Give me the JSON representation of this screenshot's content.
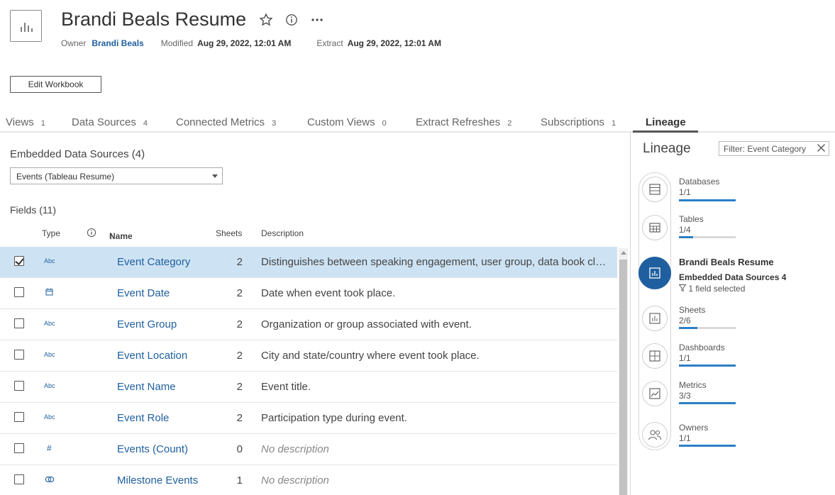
{
  "header": {
    "title": "Brandi Beals Resume",
    "owner_label": "Owner",
    "owner_value": "Brandi Beals",
    "modified_label": "Modified",
    "modified_value": "Aug 29, 2022, 12:01 AM",
    "extract_label": "Extract",
    "extract_value": "Aug 29, 2022, 12:01 AM",
    "edit_button": "Edit Workbook"
  },
  "tabs": [
    {
      "label": "Views",
      "count": "1"
    },
    {
      "label": "Data Sources",
      "count": "4"
    },
    {
      "label": "Connected Metrics",
      "count": "3"
    },
    {
      "label": "Custom Views",
      "count": "0"
    },
    {
      "label": "Extract Refreshes",
      "count": "2"
    },
    {
      "label": "Subscriptions",
      "count": "1"
    },
    {
      "label": "Lineage",
      "count": ""
    }
  ],
  "main": {
    "embedded_label": "Embedded Data Sources (4)",
    "select_value": "Events (Tableau Resume)",
    "fields_label": "Fields (11)",
    "columns": {
      "type": "Type",
      "name": "Name",
      "sort_arrow": "↑",
      "sheets": "Sheets",
      "description": "Description"
    },
    "rows": [
      {
        "checked": true,
        "type_icon": "abc-icon",
        "type_text": "Abc",
        "name": "Event Category",
        "sheets": "2",
        "description": "Distinguishes between speaking engagement, user group, data book club or other event types.",
        "empty": false
      },
      {
        "checked": false,
        "type_icon": "calendar-icon",
        "type_text": "",
        "name": "Event Date",
        "sheets": "2",
        "description": "Date when event took place.",
        "empty": false
      },
      {
        "checked": false,
        "type_icon": "abc-icon",
        "type_text": "Abc",
        "name": "Event Group",
        "sheets": "2",
        "description": "Organization or group associated with event.",
        "empty": false
      },
      {
        "checked": false,
        "type_icon": "abc-icon",
        "type_text": "Abc",
        "name": "Event Location",
        "sheets": "2",
        "description": "City and state/country where event took place.",
        "empty": false
      },
      {
        "checked": false,
        "type_icon": "abc-icon",
        "type_text": "Abc",
        "name": "Event Name",
        "sheets": "2",
        "description": "Event title.",
        "empty": false
      },
      {
        "checked": false,
        "type_icon": "abc-icon",
        "type_text": "Abc",
        "name": "Event Role",
        "sheets": "2",
        "description": "Participation type during event.",
        "empty": false
      },
      {
        "checked": false,
        "type_icon": "hash-icon",
        "type_text": "#",
        "name": "Events (Count)",
        "sheets": "0",
        "description": "No description",
        "empty": true
      },
      {
        "checked": false,
        "type_icon": "link-icon",
        "type_text": "",
        "name": "Milestone Events",
        "sheets": "1",
        "description": "No description",
        "empty": true
      }
    ]
  },
  "lineage": {
    "title": "Lineage",
    "filter": "Filter: Event Category",
    "items": [
      {
        "label": "Databases",
        "count": "1/1",
        "fraction": 1.0
      },
      {
        "label": "Tables",
        "count": "1/4",
        "fraction": 0.25
      },
      {
        "label": "Sheets",
        "count": "2/6",
        "fraction": 0.33
      },
      {
        "label": "Dashboards",
        "count": "1/1",
        "fraction": 1.0
      },
      {
        "label": "Metrics",
        "count": "3/3",
        "fraction": 1.0
      },
      {
        "label": "Owners",
        "count": "1/1",
        "fraction": 1.0
      }
    ],
    "current": {
      "title": "Brandi Beals Resume",
      "subtitle": "Embedded Data Sources 4",
      "selected": "1 field selected"
    }
  },
  "colors": {
    "link": "#1f5f9f",
    "selected_row": "#cde3f4",
    "accent_bar": "#2b7fc6"
  }
}
